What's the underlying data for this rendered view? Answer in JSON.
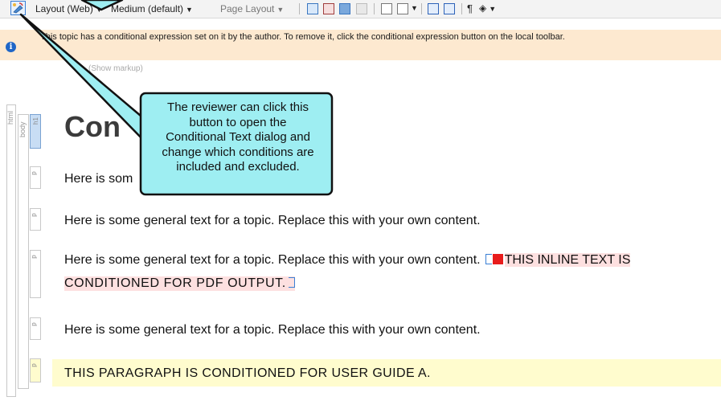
{
  "toolbar": {
    "layout_label": "Layout (Web)",
    "medium_label": "Medium (default)",
    "page_layout_label": "Page Layout",
    "pilcrow": "¶"
  },
  "infobar": {
    "icon_glyph": "i",
    "message": "This topic has a conditional expression set on it by the author. To remove it, click the conditional expression button on the local toolbar."
  },
  "markup_hint": "(Show markup)",
  "structure": {
    "html_label": "html",
    "body_label": "body",
    "h1_label": "h1",
    "p_label": "p"
  },
  "content": {
    "heading": "Con",
    "para1": "Here is som",
    "para2": "Here is some general text for a topic. Replace this with your own content.",
    "para3": "Here is some general text for a topic. Replace this with your own content.",
    "para3_cond_start": "THIS INLINE TEXT IS",
    "para3_cond_end": "CONDITIONED FOR PDF OUTPUT.",
    "para4": "Here is some general text for a topic. Replace this with your own content.",
    "para5": "THIS PARAGRAPH IS CONDITIONED FOR USER GUIDE A."
  },
  "callout": {
    "line1": "The reviewer can click this",
    "line2": "button to open the",
    "line3": "Conditional Text dialog and",
    "line4": "change which conditions are",
    "line5": "included and excluded.",
    "fill": "#9eeef2"
  }
}
